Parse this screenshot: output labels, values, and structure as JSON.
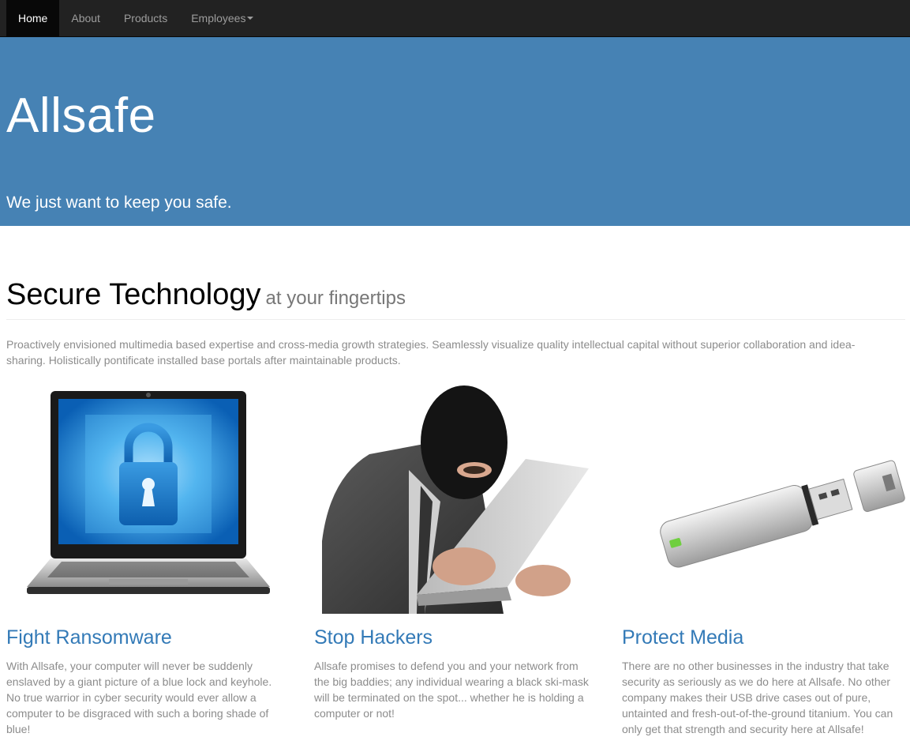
{
  "nav": {
    "items": [
      {
        "label": "Home"
      },
      {
        "label": "About"
      },
      {
        "label": "Products"
      },
      {
        "label": "Employees"
      }
    ]
  },
  "hero": {
    "title": "Allsafe",
    "tagline": "We just want to keep you safe."
  },
  "section": {
    "title": "Secure Technology",
    "subtitle": "at your fingertips",
    "intro": "Proactively envisioned multimedia based expertise and cross-media growth strategies. Seamlessly visualize quality intellectual capital without superior collaboration and idea-sharing. Holistically pontificate installed base portals after maintainable products."
  },
  "features": [
    {
      "title": "Fight Ransomware",
      "text": "With Allsafe, your computer will never be suddenly enslaved by a giant picture of a blue lock and keyhole. No true warrior in cyber security would ever allow a computer to be disgraced with such a boring shade of blue!"
    },
    {
      "title": "Stop Hackers",
      "text": "Allsafe promises to defend you and your network from the big baddies; any individual wearing a black ski-mask will be terminated on the spot... whether he is holding a computer or not!"
    },
    {
      "title": "Protect Media",
      "text": "There are no other businesses in the industry that take security as seriously as we do here at Allsafe. No other company makes their USB drive cases out of pure, untainted and fresh-out-of-the-ground titanium. You can only get that strength and security here at Allsafe!"
    }
  ],
  "colors": {
    "navbar": "#222222",
    "hero": "#4682b4",
    "link": "#337ab7"
  }
}
